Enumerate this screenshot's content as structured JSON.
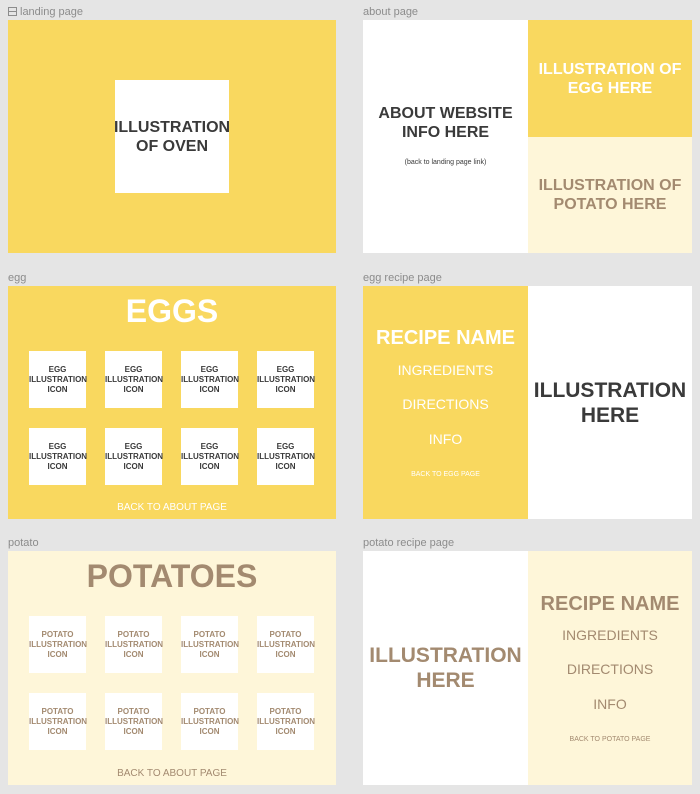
{
  "frames": {
    "landing": {
      "label": "landing page",
      "illustration": "ILLUSTRATION\nOF OVEN"
    },
    "about": {
      "label": "about page",
      "info": "ABOUT WEBSITE\nINFO HERE",
      "back_link": "(back to landing page link)",
      "egg_illustration": "ILLUSTRATION OF\nEGG HERE",
      "potato_illustration": "ILLUSTRATION OF\nPOTATO HERE"
    },
    "egg": {
      "label": "egg",
      "title": "EGGS",
      "tile_text": "EGG\nILLUSTRATION\nICON",
      "back_link": "BACK TO ABOUT PAGE"
    },
    "egg_recipe": {
      "label": "egg recipe page",
      "recipe_name": "RECIPE NAME",
      "ingredients": "INGREDIENTS",
      "directions": "DIRECTIONS",
      "info": "INFO",
      "back_link": "BACK TO EGG PAGE",
      "illustration": "ILLUSTRATION\nHERE"
    },
    "potato": {
      "label": "potato",
      "title": "POTATOES",
      "tile_text": "POTATO\nILLUSTRATION\nICON",
      "back_link": "BACK TO ABOUT PAGE"
    },
    "potato_recipe": {
      "label": "potato recipe page",
      "illustration": "ILLUSTRATION\nHERE",
      "recipe_name": "RECIPE NAME",
      "ingredients": "INGREDIENTS",
      "directions": "DIRECTIONS",
      "info": "INFO",
      "back_link": "BACK TO POTATO PAGE"
    }
  },
  "colors": {
    "canvas": "#e5e5e5",
    "yellow": "#f9d85f",
    "cream": "#fef6d9",
    "dark_text": "#3a3a3a",
    "brown_text": "#a38a70"
  }
}
